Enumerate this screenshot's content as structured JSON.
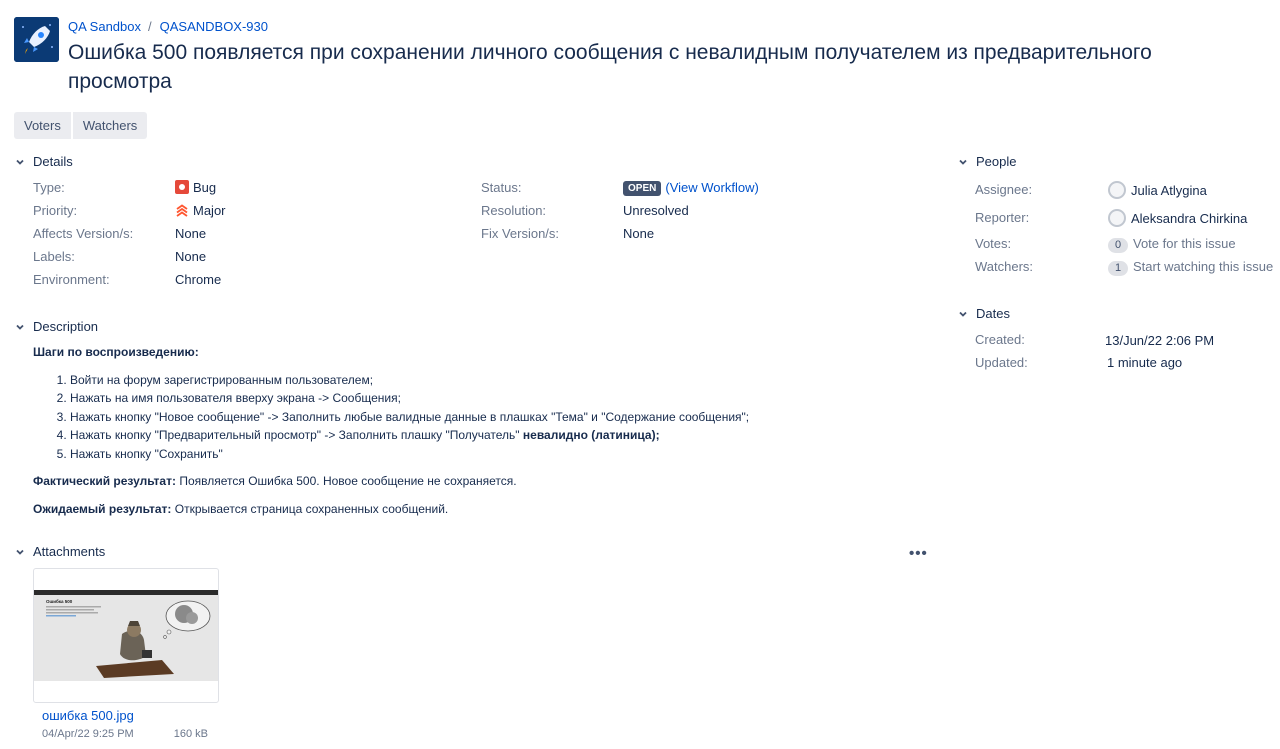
{
  "breadcrumb": {
    "project": "QA Sandbox",
    "separator": "/",
    "issue_key": "QASANDBOX-930"
  },
  "issue": {
    "summary": "Ошибка 500 появляется при сохранении личного сообщения с невалидным получателем из предварительного просмотра"
  },
  "buttons": {
    "voters": "Voters",
    "watchers": "Watchers"
  },
  "details": {
    "title": "Details",
    "type_label": "Type:",
    "type_value": "Bug",
    "priority_label": "Priority:",
    "priority_value": "Major",
    "affects_label": "Affects Version/s:",
    "affects_value": "None",
    "labels_label": "Labels:",
    "labels_value": "None",
    "environment_label": "Environment:",
    "environment_value": "Chrome",
    "status_label": "Status:",
    "status_value": "OPEN",
    "view_workflow": "View Workflow",
    "resolution_label": "Resolution:",
    "resolution_value": "Unresolved",
    "fix_label": "Fix Version/s:",
    "fix_value": "None"
  },
  "people": {
    "title": "People",
    "assignee_label": "Assignee:",
    "assignee_value": "Julia Atlygina",
    "reporter_label": "Reporter:",
    "reporter_value": "Aleksandra Chirkina",
    "votes_label": "Votes:",
    "votes_count": "0",
    "votes_action": "Vote for this issue",
    "watchers_label": "Watchers:",
    "watchers_count": "1",
    "watchers_action": "Start watching this issue"
  },
  "dates": {
    "title": "Dates",
    "created_label": "Created:",
    "created_value": "13/Jun/22 2:06 PM",
    "updated_label": "Updated:",
    "updated_value": "1 minute ago"
  },
  "description": {
    "title": "Description",
    "steps_heading": "Шаги по воспроизведению:",
    "steps": [
      "Войти на форум зарегистрированным пользователем;",
      "Нажать на имя пользователя вверху экрана -> Сообщения;",
      "Нажать кнопку \"Новое сообщение\" -> Заполнить любые валидные данные в плашках \"Тема\" и \"Содержание сообщения\";",
      "Нажать кнопку \"Предварительный просмотр\" -> Заполнить плашку \"Получатель\" ",
      "Нажать кнопку \"Сохранить\""
    ],
    "step4_bold": "невалидно (латиница);",
    "actual_label": "Фактический результат:",
    "actual_text": "Появляется Ошибка 500. Новое сообщение не сохраняется.",
    "expected_label": "Ожидаемый результат:",
    "expected_text": "Открывается страница сохраненных сообщений."
  },
  "attachments": {
    "title": "Attachments",
    "more": "•••",
    "file_name": "ошибка 500.jpg",
    "file_date": "04/Apr/22 9:25 PM",
    "file_size": "160 kB",
    "thumb_heading": "Ошибка 500"
  }
}
